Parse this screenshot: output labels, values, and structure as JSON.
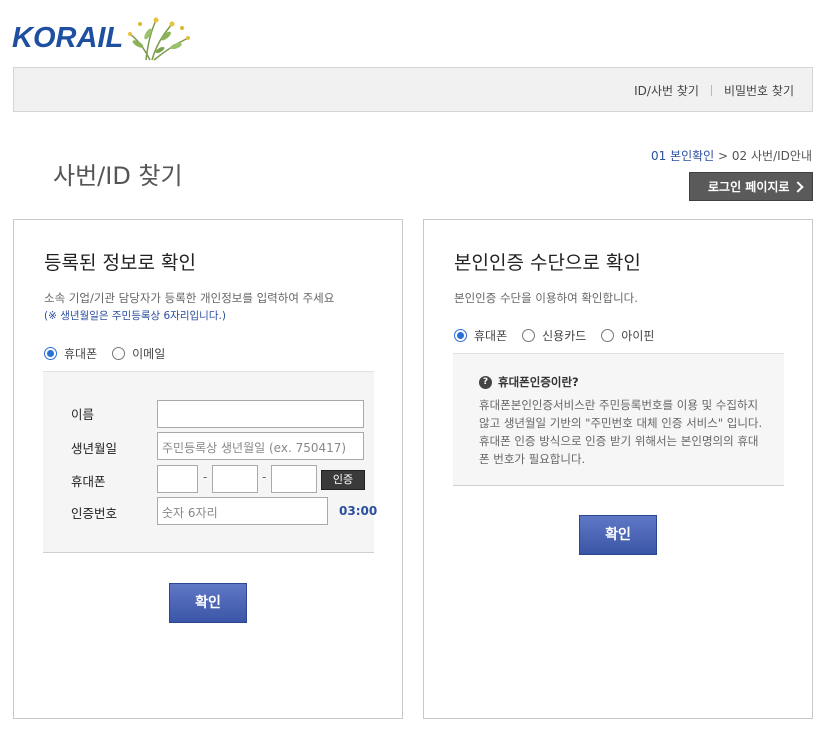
{
  "brand": {
    "logo_text": "KORAIL"
  },
  "topbar": {
    "links": [
      "ID/사번 찾기",
      "비밀번호 찾기"
    ]
  },
  "page": {
    "title": "사번/ID 찾기",
    "steps": {
      "step1": "01 본인확인",
      "arrow": ">",
      "step2": "02 사번/ID안내"
    },
    "login_button": "로그인 페이지로"
  },
  "left_panel": {
    "title": "등록된 정보로 확인",
    "description": "소속 기업/기관 담당자가 등록한 개인정보를 입력하여 주세요",
    "note": "(※ 생년월일은 주민등록상 6자리입니다.)",
    "radios": [
      {
        "label": "휴대폰",
        "checked": true
      },
      {
        "label": "이메일",
        "checked": false
      }
    ],
    "form": {
      "name_label": "이름",
      "name_value": "",
      "birth_label": "생년월일",
      "birth_placeholder": "주민등록상 생년월일 (ex. 750417)",
      "phone_label": "휴대폰",
      "phone_dash": "-",
      "auth_button": "인증",
      "code_label": "인증번호",
      "code_placeholder": "숫자 6자리",
      "timer": "03:00"
    },
    "confirm_button": "확인"
  },
  "right_panel": {
    "title": "본인인증 수단으로 확인",
    "description": "본인인증 수단을 이용하여 확인합니다.",
    "radios": [
      {
        "label": "휴대폰",
        "checked": true
      },
      {
        "label": "신용카드",
        "checked": false
      },
      {
        "label": "아이핀",
        "checked": false
      }
    ],
    "info": {
      "title": "휴대폰인증이란?",
      "text": "휴대폰본인인증서비스란 주민등록번호를 이용 및 수집하지 않고 생년월일 기반의 \"주민번호 대체 인증 서비스\" 입니다. 휴대폰 인증 방식으로 인증 받기 위해서는 본인명의의 휴대폰 번호가 필요합니다."
    },
    "confirm_button": "확인"
  },
  "colors": {
    "brand_blue": "#1e4fa0",
    "brand_red": "#e8262d",
    "button_blue": "#4a64b5",
    "dark_button": "#5a5a5a"
  }
}
